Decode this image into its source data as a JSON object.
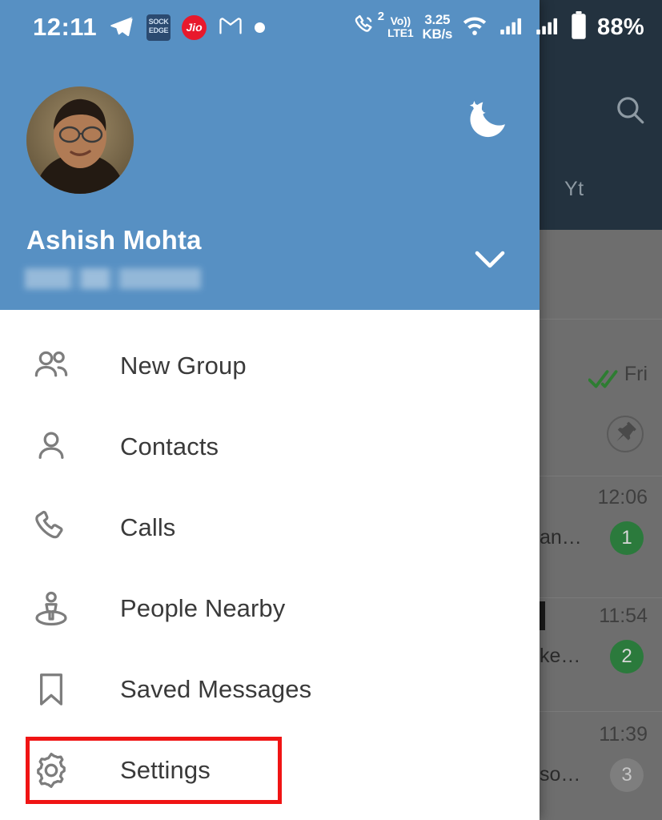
{
  "status_bar": {
    "clock": "12:11",
    "battery_percent": "88%",
    "network_speed": "3.25",
    "network_speed_unit": "KB/s",
    "volte_line1": "Vo))",
    "volte_line2": "LTE1",
    "call_sim_number": "2",
    "jio_label": "Jio",
    "sock_line1": "SOCK",
    "sock_line2": "EDGE",
    "icons": [
      "telegram-icon",
      "sock-edge-icon",
      "jio-icon",
      "gmail-icon",
      "dot-icon",
      "call-icon",
      "volte-icon",
      "data-speed-icon",
      "wifi-icon",
      "signal-1-icon",
      "signal-2-icon",
      "battery-icon"
    ]
  },
  "drawer": {
    "profile": {
      "name": "Ashish Mohta",
      "phone_redacted": "",
      "avatar_alt": "user-avatar"
    },
    "night_mode_icon": "moon-icon",
    "expand_icon": "chevron-down-icon",
    "menu": [
      {
        "label": "New Group",
        "icon": "group-icon"
      },
      {
        "label": "Contacts",
        "icon": "person-icon"
      },
      {
        "label": "Calls",
        "icon": "phone-icon"
      },
      {
        "label": "People Nearby",
        "icon": "people-nearby-icon"
      },
      {
        "label": "Saved Messages",
        "icon": "bookmark-icon"
      },
      {
        "label": "Settings",
        "icon": "gear-icon"
      }
    ]
  },
  "background": {
    "search_icon": "search-icon",
    "tab_label": "Yt",
    "chats": [
      {
        "time": "Fri",
        "snippet": "",
        "badge": "",
        "badge_type": "pin",
        "read_state": "double-check"
      },
      {
        "time": "12:06",
        "snippet": "an…",
        "badge": "1",
        "badge_type": "green",
        "read_state": ""
      },
      {
        "time": "11:54",
        "snippet": "ke…",
        "badge": "2",
        "badge_type": "green",
        "read_state": ""
      },
      {
        "time": "11:39",
        "snippet": "so…",
        "badge": "3",
        "badge_type": "muted",
        "read_state": ""
      }
    ]
  },
  "annotation": {
    "highlight_target": "Settings",
    "highlight_color": "#f01414"
  },
  "colors": {
    "drawer_header_blue": "#5790c3",
    "app_header_dark": "#23323f",
    "badge_green": "#2b7a3c",
    "dim_overlay": "#6e6e6e"
  }
}
